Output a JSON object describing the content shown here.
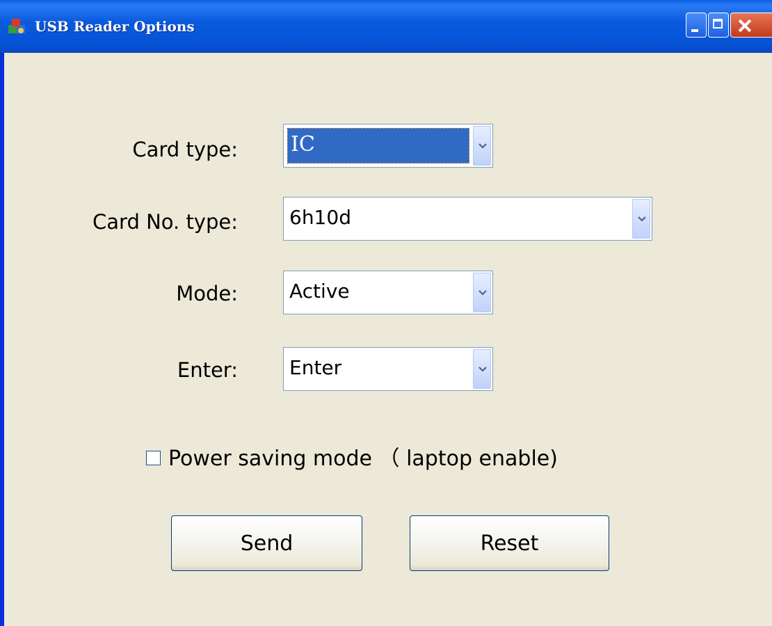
{
  "window": {
    "title": "USB Reader Options",
    "icon": "card-reader-app-icon"
  },
  "form": {
    "card_type": {
      "label": "Card type:",
      "value": "IC"
    },
    "card_no_type": {
      "label": "Card No. type:",
      "value": "6h10d"
    },
    "mode": {
      "label": "Mode:",
      "value": "Active"
    },
    "enter": {
      "label": "Enter:",
      "value": "Enter"
    },
    "power_saving": {
      "label": "Power saving mode （ laptop enable)",
      "checked": false
    }
  },
  "buttons": {
    "send": "Send",
    "reset": "Reset"
  },
  "colors": {
    "titlebar": "#0552d4",
    "window_bg": "#ece9d8",
    "selection": "#316ac5",
    "close_button": "#c4391c"
  }
}
